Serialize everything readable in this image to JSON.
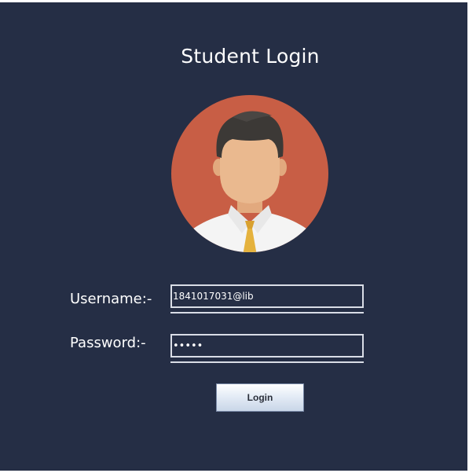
{
  "window": {
    "title": "Student Login"
  },
  "avatar": {
    "icon": "user-avatar-icon",
    "colors": {
      "circle": "#c85e45",
      "skin": "#eab98f",
      "hair": "#3c3936",
      "shirt": "#f4f4f4",
      "tie": "#e5b23d"
    }
  },
  "form": {
    "username_label": "Username:-",
    "username_value": "1841017031@lib",
    "password_label": "Password:-",
    "password_value": "•••••",
    "login_label": "Login"
  },
  "colors": {
    "background": "#252e45",
    "text": "#ffffff",
    "field_border": "#d9dde6"
  }
}
